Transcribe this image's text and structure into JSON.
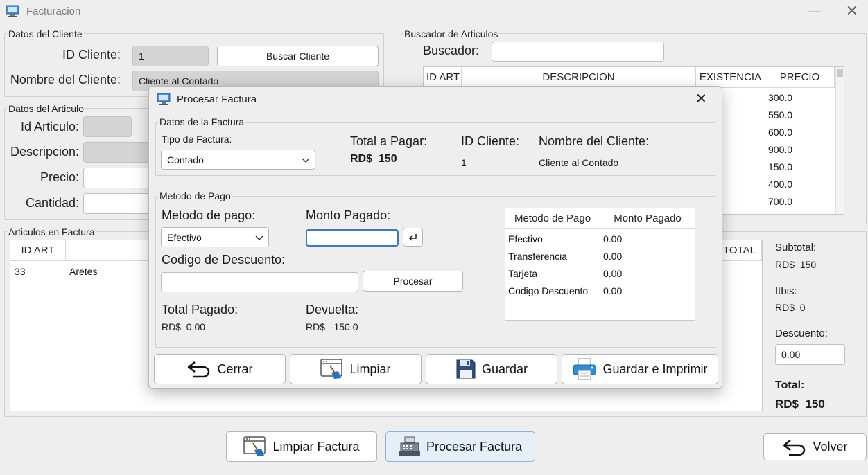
{
  "window": {
    "title": "Facturacion"
  },
  "cliente": {
    "legend": "Datos del Cliente",
    "id_label": "ID Cliente:",
    "id_value": "1",
    "buscar_button": "Buscar Cliente",
    "nombre_label": "Nombre del Cliente:",
    "nombre_value": "Cliente al Contado"
  },
  "buscador": {
    "legend": "Buscador de Articulos",
    "label": "Buscador:",
    "value": "",
    "columns": [
      "ID ART",
      "DESCRIPCION",
      "EXISTENCIA",
      "PRECIO"
    ],
    "precios": [
      "300.0",
      "550.0",
      "600.0",
      "900.0",
      "150.0",
      "400.0",
      "700.0"
    ]
  },
  "articulo": {
    "legend": "Datos del Articulo",
    "id_label": "Id Articulo:",
    "desc_label": "Descripcion:",
    "precio_label": "Precio:",
    "cantidad_label": "Cantidad:"
  },
  "factura_items": {
    "legend": "Articulos en Factura",
    "columns": [
      "ID ART",
      "TOTAL"
    ],
    "rows": [
      {
        "id": "33",
        "descripcion": "Aretes"
      }
    ]
  },
  "resumen": {
    "subtotal_label": "Subtotal:",
    "subtotal_value": "RD$  150",
    "itbis_label": "Itbis:",
    "itbis_value": "RD$  0",
    "descuento_label": "Descuento:",
    "descuento_value": "0.00",
    "total_label": "Total:",
    "total_value": "RD$  150"
  },
  "bottom": {
    "limpiar_factura": "Limpiar Factura",
    "procesar_factura": "Procesar Factura",
    "volver": "Volver"
  },
  "dialog": {
    "title": "Procesar Factura",
    "datos_legend": "Datos de la Factura",
    "tipo_label": "Tipo de Factura:",
    "tipo_value": "Contado",
    "total_pagar_label": "Total a Pagar:",
    "total_pagar_value": "RD$  150",
    "id_cliente_label": "ID Cliente:",
    "id_cliente_value": "1",
    "nombre_cliente_label": "Nombre del Cliente:",
    "nombre_cliente_value": "Cliente al Contado",
    "metodo_legend": "Metodo de Pago",
    "metodo_label": "Metodo de pago:",
    "metodo_value": "Efectivo",
    "monto_label": "Monto Pagado:",
    "monto_value": "",
    "codigo_label": "Codigo de Descuento:",
    "codigo_value": "",
    "procesar_button": "Procesar",
    "total_pagado_label": "Total Pagado:",
    "total_pagado_value": "RD$  0.00",
    "devuelta_label": "Devuelta:",
    "devuelta_value": "RD$  -150.0",
    "pagos_table": {
      "columns": [
        "Metodo de Pago",
        "Monto Pagado"
      ],
      "rows": [
        {
          "metodo": "Efectivo",
          "monto": "0.00"
        },
        {
          "metodo": "Transferencia",
          "monto": "0.00"
        },
        {
          "metodo": "Tarjeta",
          "monto": "0.00"
        },
        {
          "metodo": "Codigo Descuento",
          "monto": "0.00"
        }
      ]
    },
    "buttons": {
      "cerrar": "Cerrar",
      "limpiar": "Limpiar",
      "guardar": "Guardar",
      "guardar_imprimir": "Guardar e Imprimir"
    }
  }
}
